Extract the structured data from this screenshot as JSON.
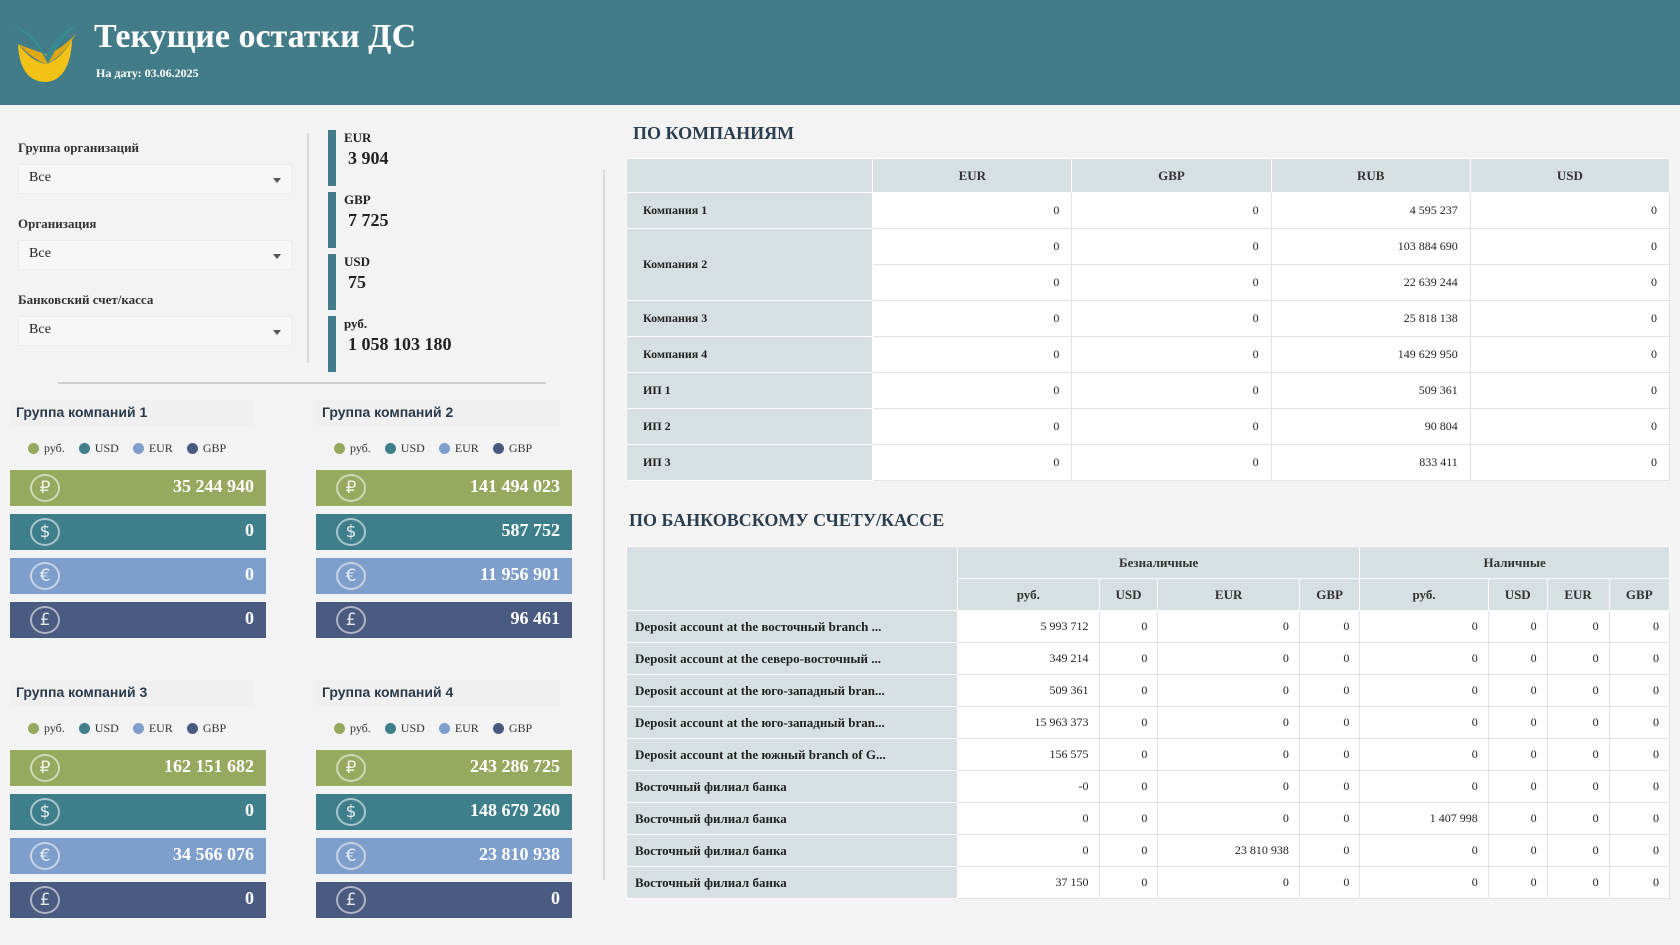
{
  "header": {
    "title": "Текущие остатки ДС",
    "subtitle": "На дату: 03.06.2025"
  },
  "filters": [
    {
      "label": "Группа организаций",
      "value": "Все"
    },
    {
      "label": "Организация",
      "value": "Все"
    },
    {
      "label": "Банковский счет/касса",
      "value": "Все"
    }
  ],
  "totals": [
    {
      "code": "EUR",
      "value": "3 904"
    },
    {
      "code": "GBP",
      "value": "7 725"
    },
    {
      "code": "USD",
      "value": "75"
    },
    {
      "code": "руб.",
      "value": "1 058 103 180"
    }
  ],
  "legend": [
    "руб.",
    "USD",
    "EUR",
    "GBP"
  ],
  "colors": {
    "rub": "#97a85f",
    "usd": "#3f7f8c",
    "eur": "#7e9ecb",
    "gbp": "#4a5a80",
    "header": "#437c89"
  },
  "groups": [
    {
      "title": "Группа компаний 1",
      "values": [
        "35 244 940",
        "0",
        "0",
        "0"
      ]
    },
    {
      "title": "Группа компаний 2",
      "values": [
        "141 494 023",
        "587 752",
        "11 956 901",
        "96 461"
      ]
    },
    {
      "title": "Группа компаний 3",
      "values": [
        "162 151 682",
        "0",
        "34 566 076",
        "0"
      ]
    },
    {
      "title": "Группа компаний 4",
      "values": [
        "243 286 725",
        "148 679 260",
        "23 810 938",
        "0"
      ]
    }
  ],
  "companies": {
    "title": "ПО КОМПАНИЯМ",
    "headers": [
      "EUR",
      "GBP",
      "RUB",
      "USD"
    ],
    "rows": [
      {
        "name": "Компания 1",
        "values": [
          "0",
          "0",
          "4 595 237",
          "0"
        ]
      },
      {
        "name": "Компания 2",
        "values": [
          "0",
          "0",
          "103 884 690",
          "0"
        ]
      },
      {
        "name": "",
        "values": [
          "0",
          "0",
          "22 639 244",
          "0"
        ]
      },
      {
        "name": "Компания 3",
        "values": [
          "0",
          "0",
          "25 818 138",
          "0"
        ]
      },
      {
        "name": "Компания 4",
        "values": [
          "0",
          "0",
          "149 629 950",
          "0"
        ]
      },
      {
        "name": "ИП 1",
        "values": [
          "0",
          "0",
          "509 361",
          "0"
        ]
      },
      {
        "name": "ИП 2",
        "values": [
          "0",
          "0",
          "90 804",
          "0"
        ]
      },
      {
        "name": "ИП 3",
        "values": [
          "0",
          "0",
          "833 411",
          "0"
        ]
      }
    ]
  },
  "accounts": {
    "title": "ПО БАНКОВСКОМУ СЧЕТУ/КАССЕ",
    "group_headers": [
      "Безналичные",
      "Наличные"
    ],
    "sub_headers": [
      "руб.",
      "USD",
      "EUR",
      "GBP",
      "руб.",
      "USD",
      "EUR",
      "GBP"
    ],
    "rows": [
      {
        "name": "Deposit account at the восточный branch ...",
        "values": [
          "5 993 712",
          "0",
          "0",
          "0",
          "0",
          "0",
          "0",
          "0"
        ]
      },
      {
        "name": "Deposit account at the северо-восточный ...",
        "values": [
          "349 214",
          "0",
          "0",
          "0",
          "0",
          "0",
          "0",
          "0"
        ]
      },
      {
        "name": "Deposit account at the юго-западный bran...",
        "values": [
          "509 361",
          "0",
          "0",
          "0",
          "0",
          "0",
          "0",
          "0"
        ]
      },
      {
        "name": "Deposit account at the юго-западный bran...",
        "values": [
          "15 963 373",
          "0",
          "0",
          "0",
          "0",
          "0",
          "0",
          "0"
        ]
      },
      {
        "name": "Deposit account at the южный branch of G...",
        "values": [
          "156 575",
          "0",
          "0",
          "0",
          "0",
          "0",
          "0",
          "0"
        ]
      },
      {
        "name": "Восточный филиал банка",
        "values": [
          "-0",
          "0",
          "0",
          "0",
          "0",
          "0",
          "0",
          "0"
        ]
      },
      {
        "name": "Восточный филиал банка",
        "values": [
          "0",
          "0",
          "0",
          "0",
          "1 407 998",
          "0",
          "0",
          "0"
        ]
      },
      {
        "name": "Восточный филиал банка",
        "values": [
          "0",
          "0",
          "23 810 938",
          "0",
          "0",
          "0",
          "0",
          "0"
        ]
      },
      {
        "name": "Восточный филиал банка",
        "values": [
          "37 150",
          "0",
          "0",
          "0",
          "0",
          "0",
          "0",
          "0"
        ]
      }
    ]
  }
}
